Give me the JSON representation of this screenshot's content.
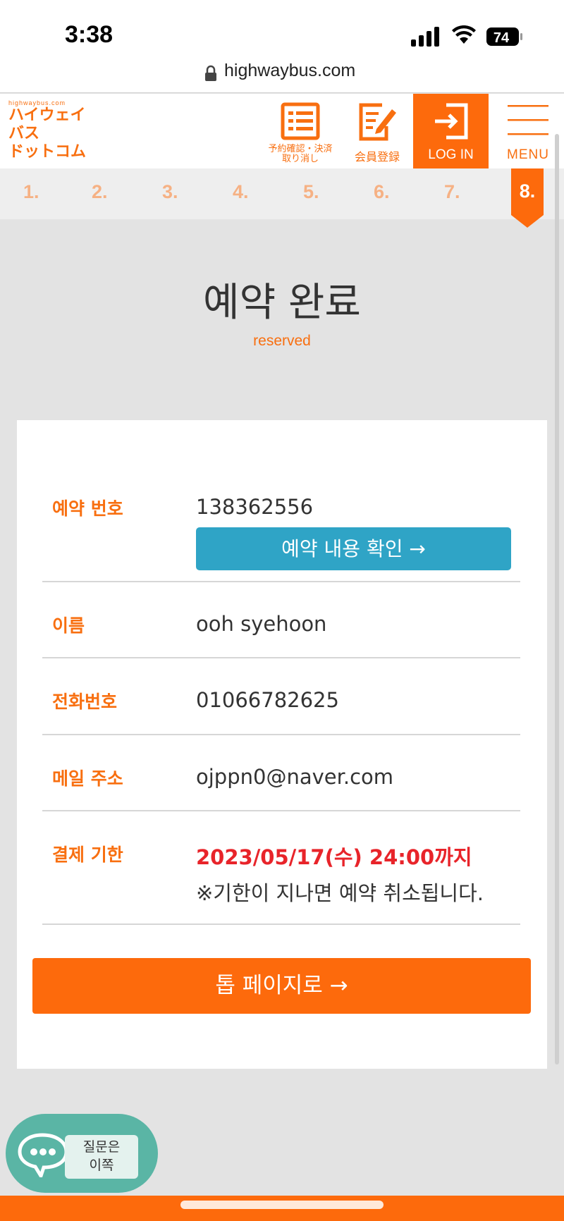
{
  "status_bar": {
    "time": "3:38",
    "battery": "74"
  },
  "browser": {
    "url": "highwaybus.com"
  },
  "header": {
    "logo_small": "highwaybus.com",
    "logo_lines": [
      "ハイウェイ",
      "バス",
      "ドットコム"
    ],
    "reserve_label_1": "予約確認・決済",
    "reserve_label_2": "取り消し",
    "member_label": "会員登録",
    "login_label": "LOG IN",
    "menu_label": "MENU"
  },
  "steps": [
    "1.",
    "2.",
    "3.",
    "4.",
    "5.",
    "6.",
    "7.",
    "8."
  ],
  "page": {
    "title": "예약 완료",
    "subtitle": "reserved"
  },
  "details": {
    "reservation_label": "예약 번호",
    "reservation_number": "138362556",
    "confirm_button": "예약 내용 확인",
    "name_label": "이름",
    "name_value": "ooh syehoon",
    "phone_label": "전화번호",
    "phone_value": "01066782625",
    "email_label": "메일 주소",
    "email_value": "ojppn0@naver.com",
    "deadline_label": "결제 기한",
    "deadline_value": "2023/05/17(수) 24:00까지",
    "deadline_note": "※기한이 지나면 예약 취소됩니다."
  },
  "top_button": "톱 페이지로",
  "chat": {
    "line1": "질문은",
    "line2": "이쪽"
  },
  "colors": {
    "accent": "#fd6a0c",
    "confirm": "#2fa4c6",
    "deadline": "#e8242a",
    "chat": "#5ab5a5"
  }
}
